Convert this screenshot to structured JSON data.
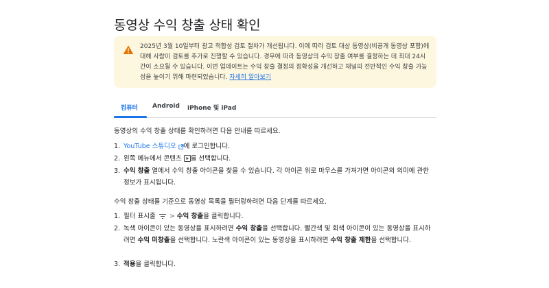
{
  "title": "동영상 수익 창출 상태 확인",
  "notice": {
    "text": "2025년 3월 10일부터 광고 적합성 검토 절차가 개선됩니다. 이에 따라 검토 대상 동영상(비공개 동영상 포함)에 대해 사람이 검토를 추가로 진행할 수 있습니다. 경우에 따라 동영상의 수익 창출 여부를 결정하는 데 최대 24시간이 소요될 수 있습니다. 이번 업데이트는 수익 창출 결정의 정확성을 개선하고 채널의 전반적인 수익 창출 가능성을 높이기 위해 마련되었습니다.",
    "link": "자세히 알아보기",
    "icon": "warning-icon",
    "accent": "#e37400"
  },
  "tabs": [
    {
      "label": "컴퓨터",
      "active": true
    },
    {
      "label": "Android",
      "active": false
    },
    {
      "label": "iPhone 및 iPad",
      "active": false
    }
  ],
  "intro1": "동영상의 수익 창출 상태를 확인하려면 다음 안내를 따르세요.",
  "steps1": [
    {
      "num": "1.",
      "link": "YouTube 스튜디오",
      "rest": "에 로그인합니다."
    },
    {
      "num": "2.",
      "pre": "왼쪽 메뉴에서 콘텐츠",
      "post": "를 선택합니다."
    },
    {
      "num": "3.",
      "bold": "수익 창출",
      "rest": " 열에서 수익 창출 아이콘을 찾을 수 있습니다. 각 아이콘 위로 마우스를 가져가면 아이콘의 의미에 관한 정보가 표시됩니다."
    }
  ],
  "intro2": "수익 창출 상태를 기준으로 동영상 목록을 필터링하려면 다음 단계를 따르세요.",
  "steps2": [
    {
      "num": "1.",
      "pre": "필터 표시줄",
      "bold": "수익 창출",
      "post": "을 클릭합니다."
    },
    {
      "num": "2.",
      "a": "녹색 아이콘이 있는 동영상을 표시하려면 ",
      "b": "수익 창출",
      "c": "을 선택합니다. 빨간색 및 회색 아이콘이 있는 동영상을 표시하려면 ",
      "d": "수익 미창출",
      "e": "을 선택합니다. 노란색 아이콘이 있는 동영상을 표시하려면 ",
      "f": "수익 창출 제한",
      "g": "을 선택합니다."
    },
    {
      "num": "3.",
      "bold": "적용",
      "rest": "을 클릭합니다."
    }
  ]
}
